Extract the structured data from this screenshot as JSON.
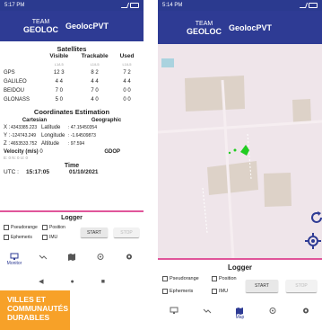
{
  "left_phone": {
    "status": {
      "time": "5:17 PM"
    },
    "app": {
      "logo_line1": "TEAM",
      "logo_line2": "GEOLOC",
      "title": "GeolocPVT"
    },
    "satellites": {
      "title": "Satellites",
      "headers": [
        "Visible",
        "Trackable",
        "Used"
      ],
      "sub": [
        "L1/L5",
        "L1/L5",
        "L1/L5"
      ],
      "rows": [
        {
          "name": "GPS",
          "visible": "12 3",
          "trackable": "8 2",
          "used": "7 2"
        },
        {
          "name": "GALILEO",
          "visible": "4 4",
          "trackable": "4 4",
          "used": "4 4"
        },
        {
          "name": "BEIDOU",
          "visible": "7 0",
          "trackable": "7 0",
          "used": "0 0"
        },
        {
          "name": "GLONASS",
          "visible": "5 0",
          "trackable": "4 0",
          "used": "0 0"
        }
      ]
    },
    "coordinates": {
      "title": "Coordinates Estimation",
      "cartesian_label": "Cartesian",
      "geographic_label": "Geographic",
      "rows": [
        {
          "axis": "X :",
          "value": "4343385.223",
          "geo_label": "Latitude",
          "geo_value": ": 47.15450354"
        },
        {
          "axis": "Y :",
          "value": "-124743.249",
          "geo_label": "Longitude",
          "geo_value": ": -1.64509873"
        },
        {
          "axis": "Z :",
          "value": "4653533.752",
          "geo_label": "Altitude",
          "geo_value": ": 97.594"
        }
      ],
      "velocity_label": "Velocity (m/s)",
      "velocity_value": "0",
      "gdop_label": "GDOP",
      "small_values": "E: 0  N: 0  U: 0"
    },
    "time": {
      "title": "Time",
      "utc_label": "UTC :",
      "utc_time": "15:17:05",
      "date": "01/10/2021"
    },
    "logger": {
      "title": "Logger",
      "pseudorange": "Pseudorange",
      "position": "Position",
      "ephemeris": "Ephemeris",
      "imu": "IMU",
      "start": "START",
      "stop": "STOP"
    },
    "nav": {
      "monitor": "Monitor"
    }
  },
  "right_phone": {
    "status": {
      "time": "5:14 PM"
    },
    "app": {
      "logo_line1": "TEAM",
      "logo_line2": "GEOLOC",
      "title": "GeolocPVT"
    },
    "logger": {
      "title": "Logger",
      "pseudorange": "Pseudorange",
      "position": "Position",
      "ephemeris": "Ephemeris",
      "imu": "IMU",
      "start": "START",
      "stop": "STOP"
    },
    "nav": {
      "map": "Map"
    }
  },
  "banner": {
    "line1": "VILLES ET",
    "line2": "COMMUNAUTÉS",
    "line3": "DURABLES"
  },
  "colors": {
    "appbar": "#2e3b94",
    "accent_pink": "#e0559a",
    "map_bg": "#efe5ea",
    "banner": "#f7a128",
    "marker": "#22cc22"
  }
}
